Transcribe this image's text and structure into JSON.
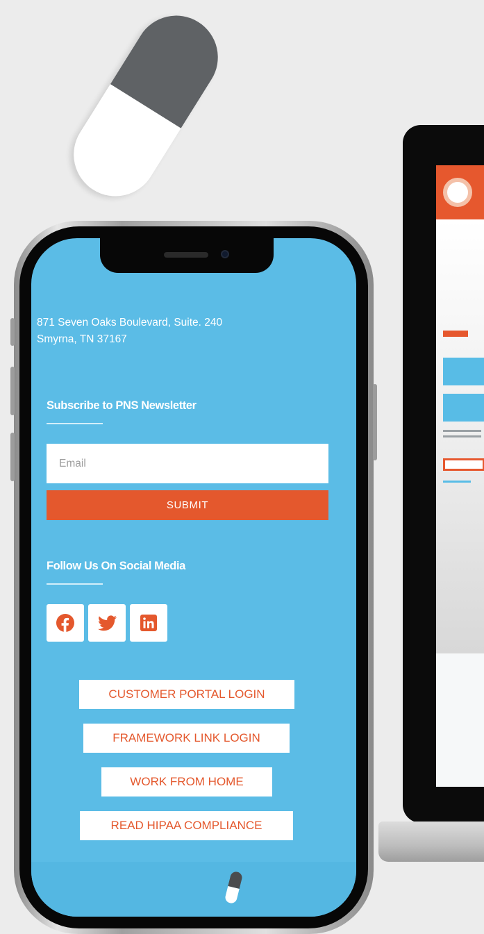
{
  "footer": {
    "address_line1": "871 Seven Oaks Boulevard, Suite. 240",
    "address_line2": "Smyrna, TN 37167"
  },
  "newsletter": {
    "title": "Subscribe to PNS Newsletter",
    "email_placeholder": "Email",
    "email_value": "",
    "submit_label": "SUBMIT"
  },
  "social": {
    "title": "Follow Us On Social Media",
    "icons": [
      "facebook-icon",
      "twitter-icon",
      "linkedin-icon"
    ]
  },
  "links": {
    "customer_portal": "CUSTOMER PORTAL LOGIN",
    "framework_link": "FRAMEWORK LINK LOGIN",
    "work_from_home": "WORK FROM HOME",
    "hipaa": "READ HIPAA COMPLIANCE"
  },
  "colors": {
    "brand_blue": "#5bbce6",
    "brand_orange": "#e4582d",
    "pill_gray": "#5f6265"
  }
}
